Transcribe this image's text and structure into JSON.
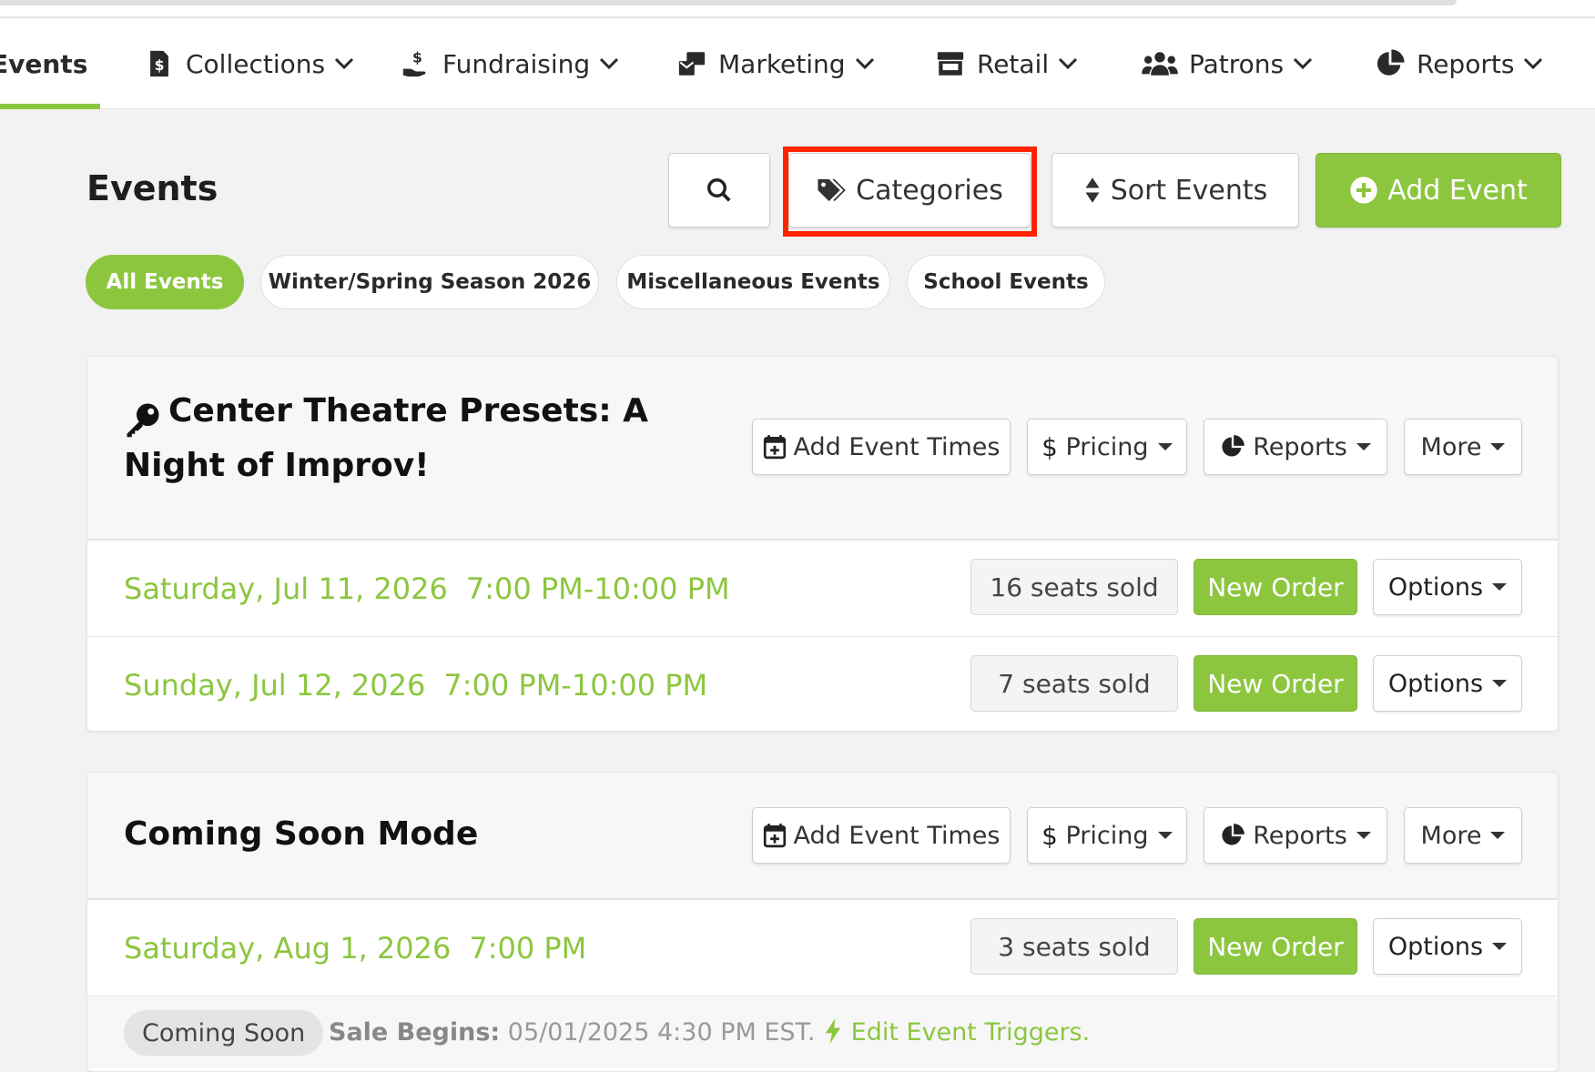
{
  "nav": {
    "items": [
      {
        "label": "Events",
        "icon": "calendar-icon"
      },
      {
        "label": "Collections",
        "icon": "dollar-doc-icon"
      },
      {
        "label": "Fundraising",
        "icon": "hand-dollar-icon"
      },
      {
        "label": "Marketing",
        "icon": "mail-bulk-icon"
      },
      {
        "label": "Retail",
        "icon": "store-icon"
      },
      {
        "label": "Patrons",
        "icon": "users-icon"
      },
      {
        "label": "Reports",
        "icon": "pie-chart-icon"
      }
    ]
  },
  "header": {
    "title": "Events",
    "categories_label": "Categories",
    "sort_label": "Sort Events",
    "add_label": "Add Event"
  },
  "filters": [
    "All Events",
    "Winter/Spring Season 2026",
    "Miscellaneous Events",
    "School Events"
  ],
  "events": [
    {
      "title_line1": "Center Theatre Presets: A",
      "title_line2": "Night of Improv!",
      "actions": {
        "add_times": "Add Event Times",
        "pricing": "Pricing",
        "reports": "Reports",
        "more": "More"
      },
      "times": [
        {
          "date": "Saturday, Jul 11, 2026",
          "time": "7:00 PM-10:00 PM",
          "seats": "16 seats sold",
          "new_order": "New Order",
          "options": "Options"
        },
        {
          "date": "Sunday, Jul 12, 2026",
          "time": "7:00 PM-10:00 PM",
          "seats": "7 seats sold",
          "new_order": "New Order",
          "options": "Options"
        }
      ]
    },
    {
      "title_line1": "Coming Soon Mode",
      "actions": {
        "add_times": "Add Event Times",
        "pricing": "Pricing",
        "reports": "Reports",
        "more": "More"
      },
      "times": [
        {
          "date": "Saturday, Aug 1, 2026",
          "time": "7:00 PM",
          "seats": "3 seats sold",
          "new_order": "New Order",
          "options": "Options"
        }
      ],
      "footer": {
        "badge": "Coming Soon",
        "sale_label": "Sale Begins:",
        "sale_value": "05/01/2025 4:30 PM EST.",
        "trigger_link": "Edit Event Triggers."
      }
    }
  ],
  "colors": {
    "accent": "#8cc63f",
    "highlight": "#ff2200"
  }
}
